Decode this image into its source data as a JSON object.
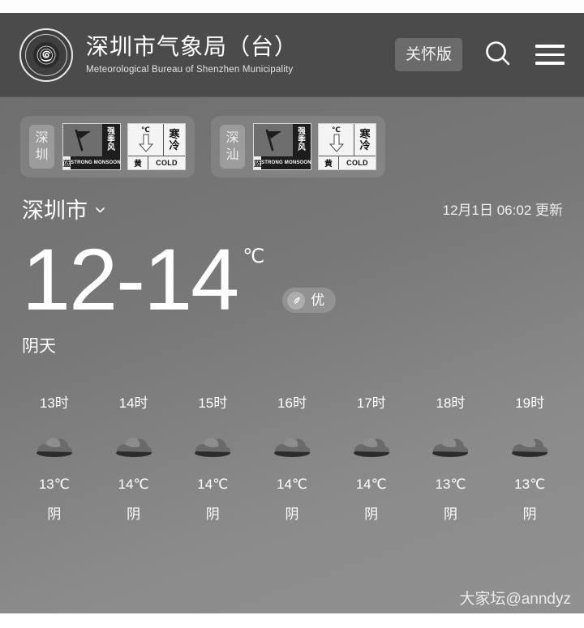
{
  "header": {
    "logo_icon": "shenzhen-meteorological-emblem",
    "title_cn": "深圳市气象局（台）",
    "title_en": "Meteorological Bureau of Shenzhen Municipality",
    "care_button_label": "关怀版",
    "search_icon": "search-icon",
    "menu_icon": "hamburger-menu-icon"
  },
  "warnings": [
    {
      "city_chars": [
        "深",
        "圳"
      ],
      "signals": [
        {
          "type": "strong-monsoon",
          "icon": "monsoon-flag-icon",
          "name_cn": "强季风",
          "level_cn": "蓝",
          "name_en": "STRONG MONSOON"
        },
        {
          "type": "cold",
          "icon": "temperature-down-arrow-icon",
          "unit": "℃",
          "name_cn": "寒冷",
          "level_cn": "黄",
          "name_en": "COLD"
        }
      ]
    },
    {
      "city_chars": [
        "深",
        "汕"
      ],
      "signals": [
        {
          "type": "strong-monsoon",
          "icon": "monsoon-flag-icon",
          "name_cn": "强季风",
          "level_cn": "蓝",
          "name_en": "STRONG MONSOON"
        },
        {
          "type": "cold",
          "icon": "temperature-down-arrow-icon",
          "unit": "℃",
          "name_cn": "寒冷",
          "level_cn": "黄",
          "name_en": "COLD"
        }
      ]
    }
  ],
  "city": {
    "name": "深圳市",
    "chevron_icon": "chevron-down-icon"
  },
  "update": {
    "text": "12月1日 06:02 更新"
  },
  "current": {
    "temperature_range": "12-14",
    "unit": "℃",
    "aqi_icon": "leaf-icon",
    "aqi_label": "优",
    "condition": "阴天"
  },
  "hourly": {
    "columns": [
      {
        "hour": "13时",
        "icon": "cloudy-icon",
        "temp": "13℃",
        "cond": "阴"
      },
      {
        "hour": "14时",
        "icon": "cloudy-icon",
        "temp": "14℃",
        "cond": "阴"
      },
      {
        "hour": "15时",
        "icon": "cloudy-icon",
        "temp": "14℃",
        "cond": "阴"
      },
      {
        "hour": "16时",
        "icon": "cloudy-icon",
        "temp": "14℃",
        "cond": "阴"
      },
      {
        "hour": "17时",
        "icon": "cloudy-icon",
        "temp": "14℃",
        "cond": "阴"
      },
      {
        "hour": "18时",
        "icon": "cloudy-icon",
        "temp": "13℃",
        "cond": "阴"
      },
      {
        "hour": "19时",
        "icon": "cloudy-icon",
        "temp": "13℃",
        "cond": "阴"
      }
    ]
  },
  "watermark": {
    "text": "大家坛@anndyz"
  },
  "colors": {
    "header_bg": "#4b4b4b",
    "body_bg_top": "#6f6f6f",
    "body_bg_bottom": "#909090",
    "text_primary": "#ffffff"
  }
}
